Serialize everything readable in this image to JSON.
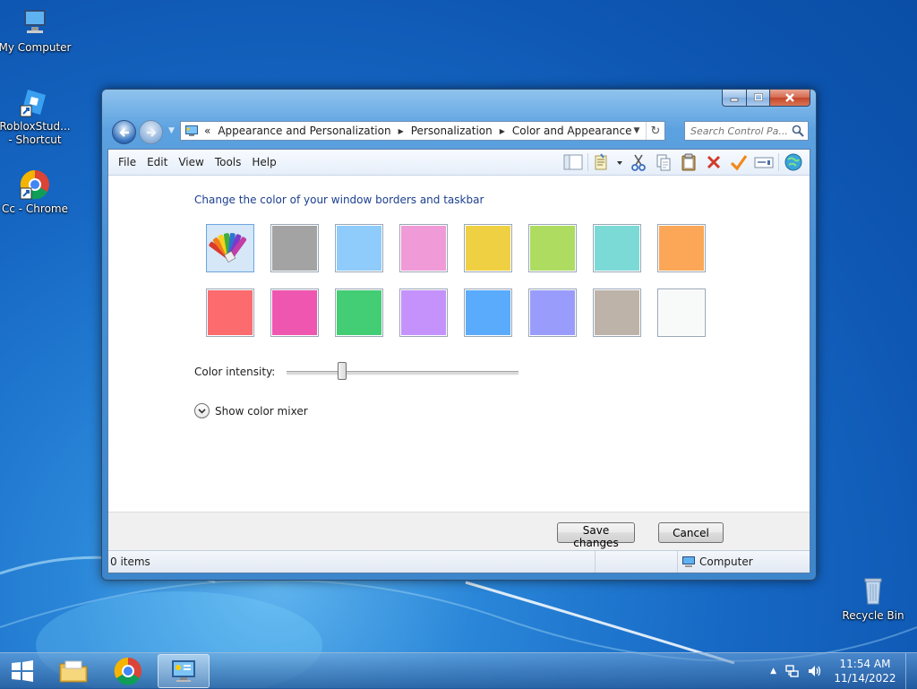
{
  "desktop": {
    "icons": [
      {
        "label": "My Computer"
      },
      {
        "label": "RobloxStud...\n- Shortcut"
      },
      {
        "label": "Cc - Chrome"
      },
      {
        "label": "Recycle Bin"
      }
    ]
  },
  "window": {
    "address": {
      "overflow": "«",
      "segments": [
        "Appearance and Personalization",
        "Personalization",
        "Color and Appearance"
      ]
    },
    "search": {
      "placeholder": "Search Control Pa..."
    },
    "menu": [
      "File",
      "Edit",
      "View",
      "Tools",
      "Help"
    ],
    "toolbar_icons": [
      "layout-icon",
      "properties-icon",
      "cut-icon",
      "copy-icon",
      "paste-icon",
      "delete-icon",
      "checkmark-icon",
      "rename-icon",
      "globe-icon"
    ],
    "heading": "Change the color of your window borders and taskbar",
    "swatches": [
      {
        "name": "custom",
        "color": "#d6e7f8",
        "selected": true
      },
      {
        "name": "slate",
        "color": "#a3a3a3"
      },
      {
        "name": "sky",
        "color": "#8fcbfb"
      },
      {
        "name": "twilight-pink",
        "color": "#f09ad7"
      },
      {
        "name": "pumpkin-yellow",
        "color": "#efd043"
      },
      {
        "name": "leaf",
        "color": "#addc61"
      },
      {
        "name": "sea-foam",
        "color": "#7cdad6"
      },
      {
        "name": "tangerine",
        "color": "#fba757"
      },
      {
        "name": "ruby",
        "color": "#fc6b6d"
      },
      {
        "name": "fuchsia",
        "color": "#ef56b0"
      },
      {
        "name": "emerald",
        "color": "#43cd74"
      },
      {
        "name": "lavender",
        "color": "#c592fb"
      },
      {
        "name": "ocean",
        "color": "#5aabfc"
      },
      {
        "name": "violet",
        "color": "#9a9cfc"
      },
      {
        "name": "taupe",
        "color": "#bdb3a8"
      },
      {
        "name": "frost",
        "color": "#f8fafa"
      }
    ],
    "intensity_label": "Color intensity:",
    "intensity_value": 0.24,
    "mixer_label": "Show color mixer",
    "save_label": "Save changes",
    "cancel_label": "Cancel",
    "status_items": "0 items",
    "status_location": "Computer"
  },
  "taskbar": {
    "time": "11:54 AM",
    "date": "11/14/2022"
  }
}
